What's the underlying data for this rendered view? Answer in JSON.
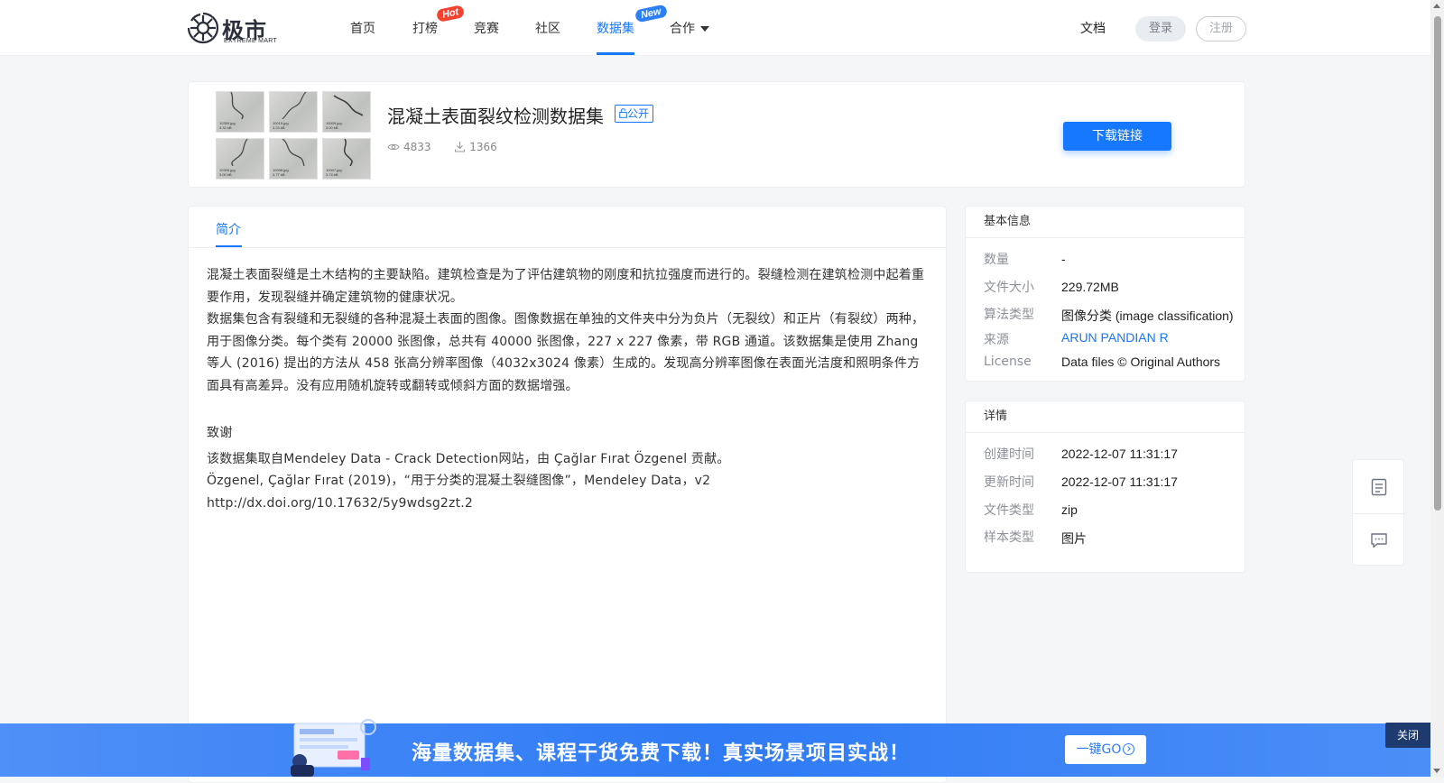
{
  "header": {
    "logo_text": "极市",
    "logo_sub": "EXTREME MART",
    "nav": [
      {
        "label": "首页"
      },
      {
        "label": "打榜",
        "badge": "Hot"
      },
      {
        "label": "竞赛"
      },
      {
        "label": "社区"
      },
      {
        "label": "数据集",
        "badge": "New",
        "active": true
      },
      {
        "label": "合作"
      }
    ],
    "docs": "文档",
    "login": "登录",
    "register": "注册"
  },
  "dataset": {
    "title": "混凝土表面裂纹检测数据集",
    "visibility": "公开",
    "views": "4833",
    "downloads": "1366",
    "download_button": "下载链接",
    "thumbnails": [
      {
        "name": "10359.jpg",
        "size": "3.32 kB"
      },
      {
        "name": "10015.jpg",
        "size": "3.23 kB"
      },
      {
        "name": "10009.jpg",
        "size": "3.00 kB"
      },
      {
        "name": "10305.jpg",
        "size": "3.00 kB"
      },
      {
        "name": "10008.jpg",
        "size": "3.77 kB"
      },
      {
        "name": "10007.jpg",
        "size": "3.74 kB"
      }
    ]
  },
  "tabs": {
    "intro": "简介"
  },
  "intro": {
    "p1": "混凝土表面裂缝是土木结构的主要缺陷。建筑检查是为了评估建筑物的刚度和抗拉强度而进行的。裂缝检测在建筑检测中起着重要作用，发现裂缝并确定建筑物的健康状况。",
    "p2": "数据集包含有裂缝和无裂缝的各种混凝土表面的图像。图像数据在单独的文件夹中分为负片（无裂纹）和正片（有裂纹）两种，用于图像分类。每个类有 20000 张图像，总共有 40000 张图像，227 x 227 像素，带 RGB 通道。该数据集是使用 Zhang 等人 (2016) 提出的方法从 458 张高分辨率图像（4032x3024 像素）生成的。发现高分辨率图像在表面光洁度和照明条件方面具有高差异。没有应用随机旋转或翻转或倾斜方面的数据增强。",
    "ack_title": "致谢",
    "ack1": "该数据集取自Mendeley Data - Crack Detection网站，由 Çağlar Fırat Özgenel 贡献。",
    "ack2": "Özgenel, Çağlar Fırat (2019)，“用于分类的混凝土裂缝图像”，Mendeley Data，v2",
    "ack3": "http://dx.doi.org/10.17632/5y9wdsg2zt.2"
  },
  "basic_info": {
    "heading": "基本信息",
    "rows": [
      {
        "key": "数量",
        "value": "-"
      },
      {
        "key": "文件大小",
        "value": "229.72MB"
      },
      {
        "key": "算法类型",
        "value": "图像分类 (image classification)"
      },
      {
        "key": "来源",
        "value": "ARUN PANDIAN R"
      },
      {
        "key": "License",
        "value": "Data files © Original Authors"
      }
    ]
  },
  "details": {
    "heading": "详情",
    "rows": [
      {
        "key": "创建时间",
        "value": "2022-12-07 11:31:17"
      },
      {
        "key": "更新时间",
        "value": "2022-12-07 11:31:17"
      },
      {
        "key": "文件类型",
        "value": "zip"
      },
      {
        "key": "样本类型",
        "value": "图片"
      }
    ]
  },
  "banner": {
    "text": "海量数据集、课程干货免费下载！真实场景项目实战！",
    "go": "一键GO",
    "close": "关闭"
  },
  "colors": {
    "accent": "#1677ff",
    "hot": "#f5412d",
    "banner": "#2f7bf5"
  }
}
